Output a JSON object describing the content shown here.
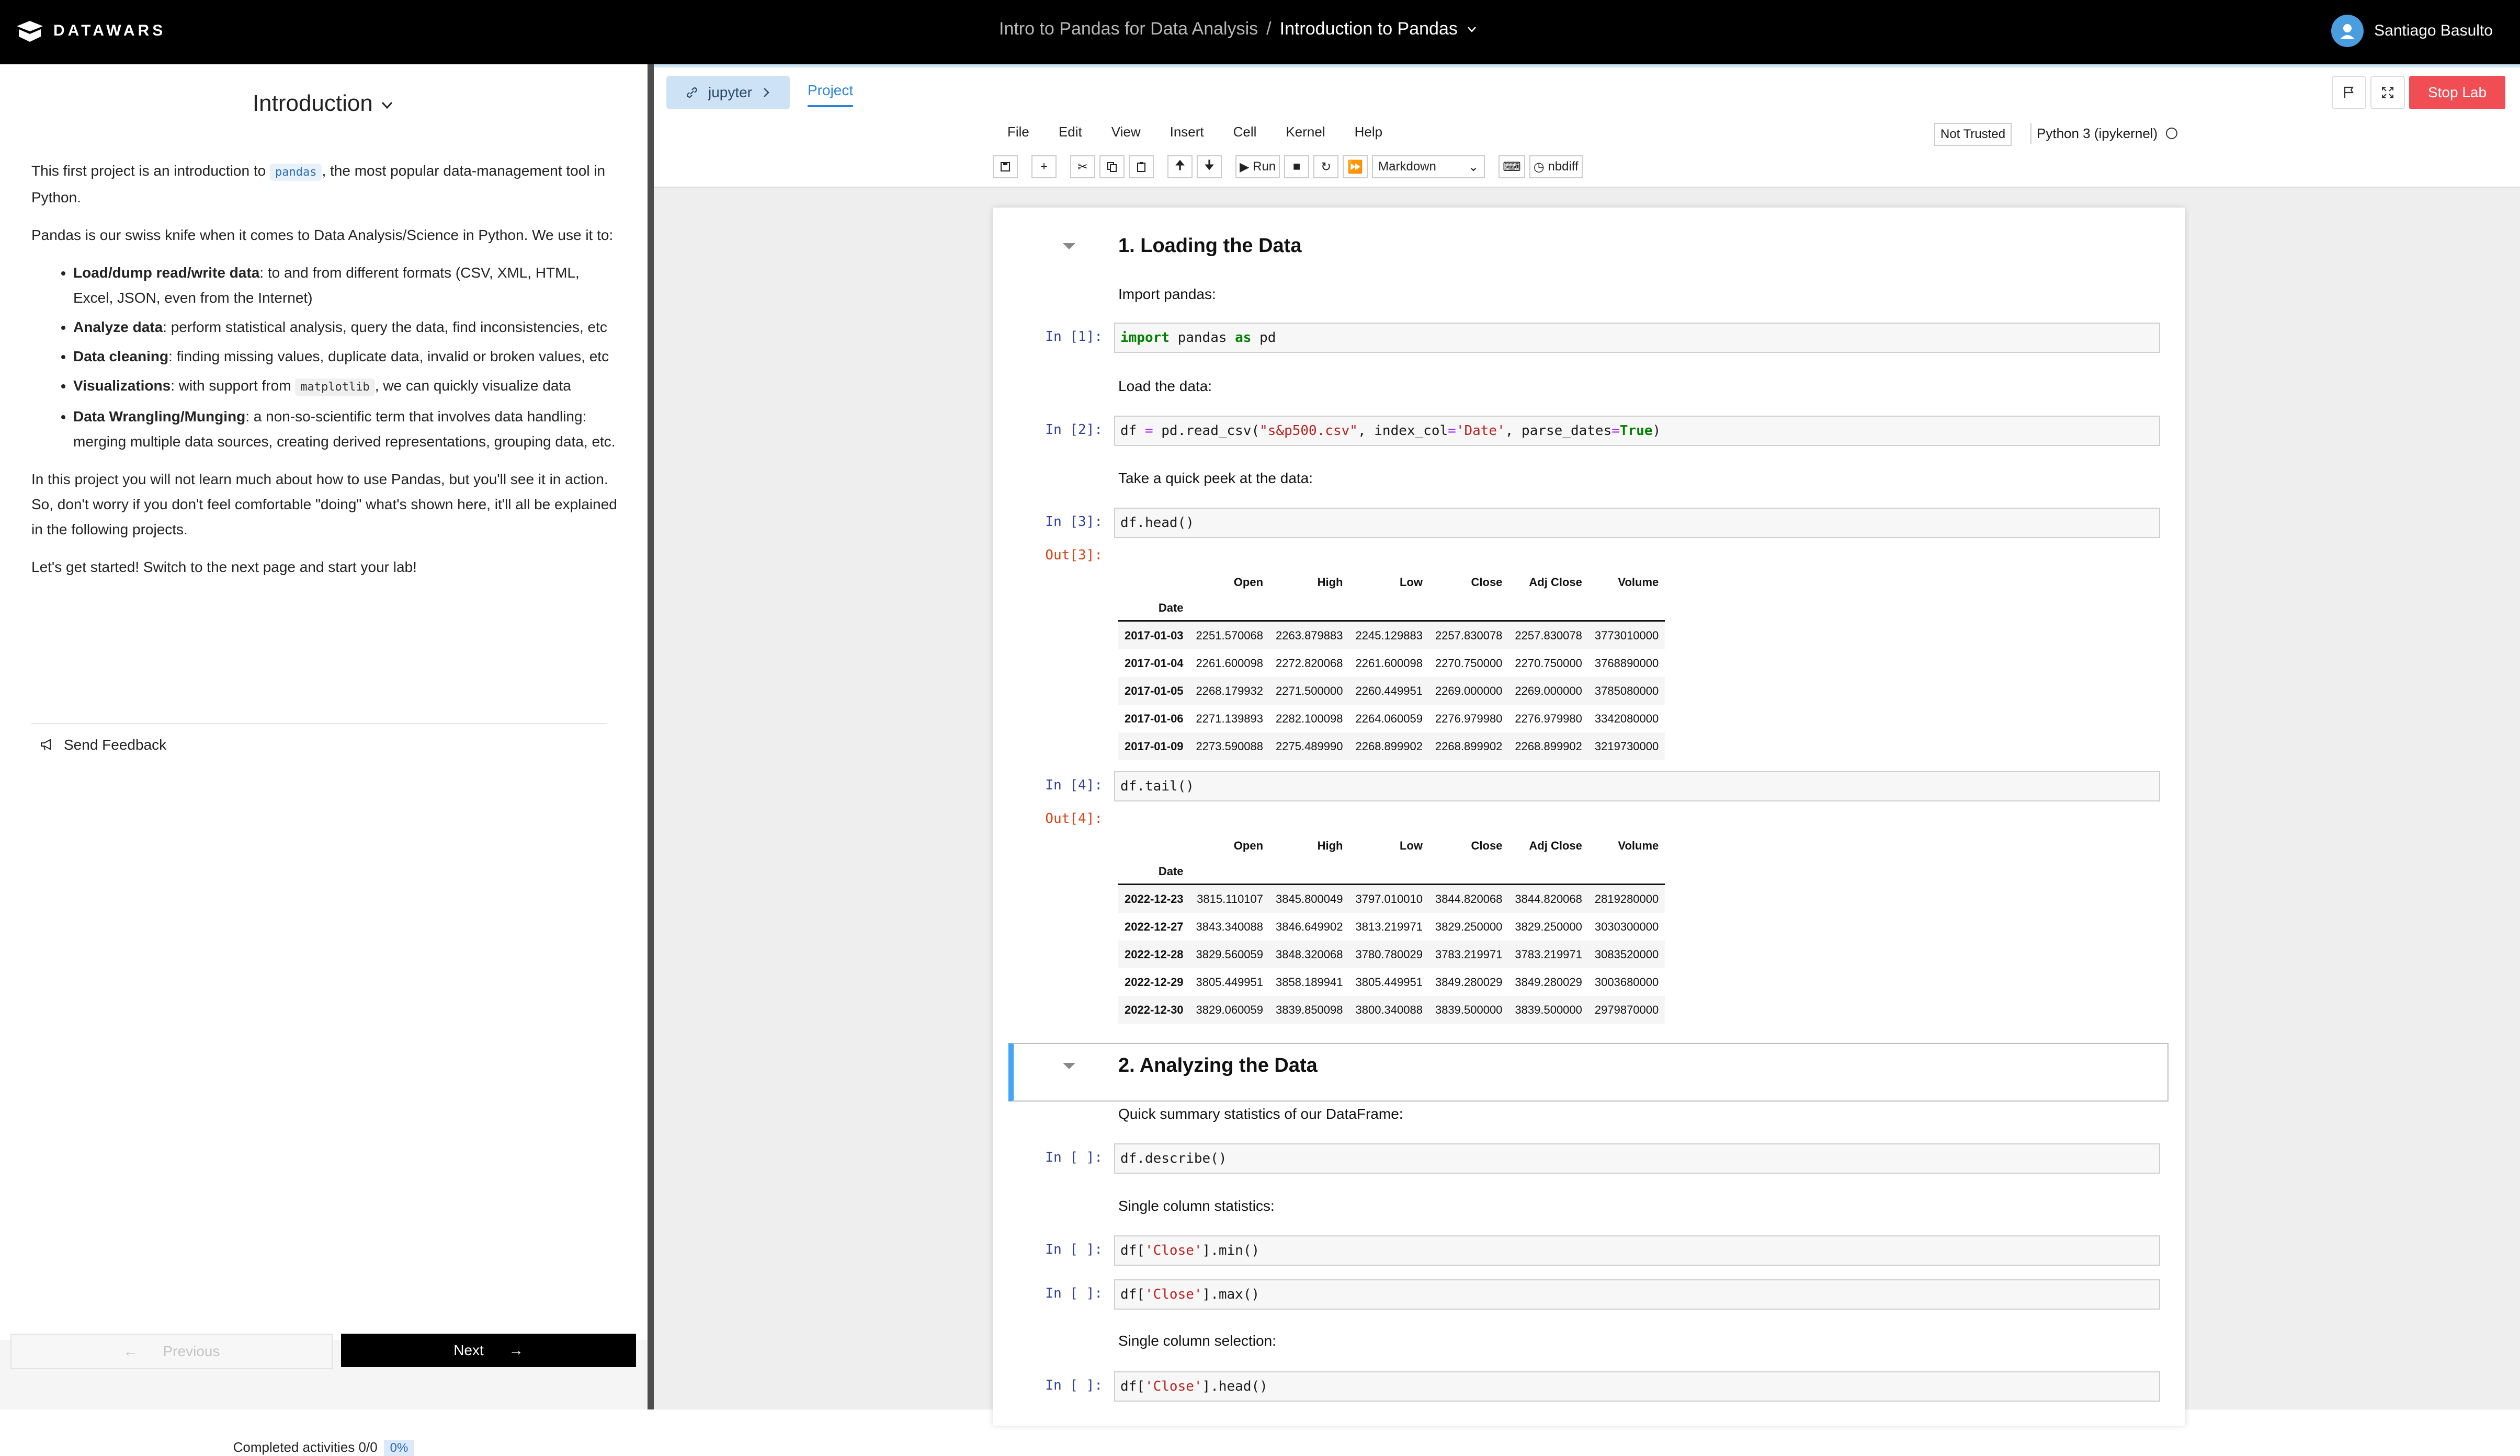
{
  "header": {
    "brand": "DATAWARS",
    "breadcrumb_course": "Intro to Pandas for Data Analysis",
    "breadcrumb_sep": "/",
    "breadcrumb_page": "Introduction to Pandas",
    "user_name": "Santiago Basulto"
  },
  "lesson": {
    "title": "Introduction",
    "p1_before": "This first project is an introduction to ",
    "p1_code": "pandas",
    "p1_after": ", the most popular data-management tool in Python.",
    "p2": "Pandas is our swiss knife when it comes to Data Analysis/Science in Python. We use it to:",
    "bullets": [
      {
        "bold": "Load/dump read/write data",
        "text": ": to and from different formats (CSV, XML, HTML, Excel, JSON, even from the Internet)"
      },
      {
        "bold": "Analyze data",
        "text": ": perform statistical analysis, query the data, find inconsistencies, etc"
      },
      {
        "bold": "Data cleaning",
        "text": ": finding missing values, duplicate data, invalid or broken values, etc"
      },
      {
        "bold": "Visualizations",
        "text_before": ": with support from ",
        "code": "matplotlib",
        "text": ", we can quickly visualize data"
      },
      {
        "bold": "Data Wrangling/Munging",
        "text": ": a non-so-scientific term that involves data handling: merging multiple data sources, creating derived representations, grouping data, etc."
      }
    ],
    "p3": "In this project you will not learn much about how to use Pandas, but you'll see it in action. So, don't worry if you don't feel comfortable \"doing\" what's shown here, it'll all be explained in the following projects.",
    "p4": "Let's get started! Switch to the next page and start your lab!",
    "feedback": "Send Feedback",
    "prev_label": "Previous",
    "next_label": "Next",
    "completed": "Completed activities 0/0",
    "progress": "0%"
  },
  "tabs": {
    "jupyter": "jupyter",
    "project": "Project",
    "stop": "Stop Lab"
  },
  "jupyter": {
    "menu": [
      "File",
      "Edit",
      "View",
      "Insert",
      "Cell",
      "Kernel",
      "Help"
    ],
    "trusted": "Not Trusted",
    "kernel": "Python 3 (ipykernel)",
    "run_label": "Run",
    "celltype": "Markdown",
    "nbdiff": "nbdiff"
  },
  "notebook": {
    "h1": "1. Loading the Data",
    "md_import": "Import pandas:",
    "in1_prompt": "In [1]:",
    "in1": {
      "kw1": "import",
      "mid": " pandas ",
      "kw2": "as",
      "end": " pd"
    },
    "md_load": "Load the data:",
    "in2_prompt": "In [2]:",
    "in2": {
      "a": "df ",
      "eq": "=",
      "b": " pd.read_csv(",
      "s1": "\"s&p500.csv\"",
      "c": ", index_col",
      "eq2": "=",
      "s2": "'Date'",
      "d": ", parse_dates",
      "eq3": "=",
      "kw": "True",
      "e": ")"
    },
    "md_peek": "Take a quick peek at the data:",
    "in3_prompt": "In [3]:",
    "in3": "df.head()",
    "out3_prompt": "Out[3]:",
    "in4_prompt": "In [4]:",
    "in4": "df.tail()",
    "out4_prompt": "Out[4]:",
    "columns": [
      "Open",
      "High",
      "Low",
      "Close",
      "Adj Close",
      "Volume"
    ],
    "index_name": "Date",
    "head_rows": [
      [
        "2017-01-03",
        "2251.570068",
        "2263.879883",
        "2245.129883",
        "2257.830078",
        "2257.830078",
        "3773010000"
      ],
      [
        "2017-01-04",
        "2261.600098",
        "2272.820068",
        "2261.600098",
        "2270.750000",
        "2270.750000",
        "3768890000"
      ],
      [
        "2017-01-05",
        "2268.179932",
        "2271.500000",
        "2260.449951",
        "2269.000000",
        "2269.000000",
        "3785080000"
      ],
      [
        "2017-01-06",
        "2271.139893",
        "2282.100098",
        "2264.060059",
        "2276.979980",
        "2276.979980",
        "3342080000"
      ],
      [
        "2017-01-09",
        "2273.590088",
        "2275.489990",
        "2268.899902",
        "2268.899902",
        "2268.899902",
        "3219730000"
      ]
    ],
    "tail_rows": [
      [
        "2022-12-23",
        "3815.110107",
        "3845.800049",
        "3797.010010",
        "3844.820068",
        "3844.820068",
        "2819280000"
      ],
      [
        "2022-12-27",
        "3843.340088",
        "3846.649902",
        "3813.219971",
        "3829.250000",
        "3829.250000",
        "3030300000"
      ],
      [
        "2022-12-28",
        "3829.560059",
        "3848.320068",
        "3780.780029",
        "3783.219971",
        "3783.219971",
        "3083520000"
      ],
      [
        "2022-12-29",
        "3805.449951",
        "3858.189941",
        "3805.449951",
        "3849.280029",
        "3849.280029",
        "3003680000"
      ],
      [
        "2022-12-30",
        "3829.060059",
        "3839.850098",
        "3800.340088",
        "3839.500000",
        "3839.500000",
        "2979870000"
      ]
    ],
    "h2": "2. Analyzing the Data",
    "md_summary": "Quick summary statistics of our DataFrame:",
    "in_empty_prompt": "In [ ]:",
    "in5": "df.describe()",
    "md_colstats": "Single column statistics:",
    "in6": {
      "a": "df[",
      "s": "'Close'",
      "b": "].min()"
    },
    "in7": {
      "a": "df[",
      "s": "'Close'",
      "b": "].max()"
    },
    "md_colsel": "Single column selection:",
    "in8": {
      "a": "df[",
      "s": "'Close'",
      "b": "].head()"
    }
  }
}
